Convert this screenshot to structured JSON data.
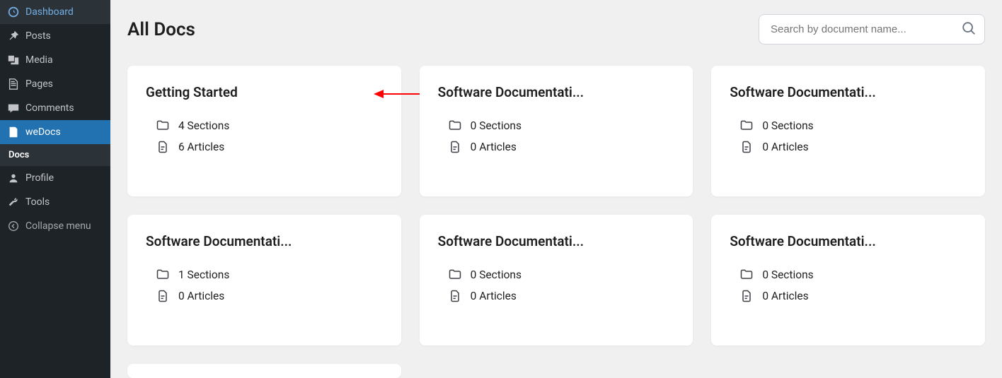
{
  "sidebar": {
    "items": [
      {
        "id": "dashboard",
        "label": "Dashboard",
        "icon": "dashboard"
      },
      {
        "id": "posts",
        "label": "Posts",
        "icon": "pin"
      },
      {
        "id": "media",
        "label": "Media",
        "icon": "media"
      },
      {
        "id": "pages",
        "label": "Pages",
        "icon": "page"
      },
      {
        "id": "comments",
        "label": "Comments",
        "icon": "comment"
      },
      {
        "id": "wedocs",
        "label": "weDocs",
        "icon": "doc",
        "active": true
      },
      {
        "id": "profile",
        "label": "Profile",
        "icon": "user"
      },
      {
        "id": "tools",
        "label": "Tools",
        "icon": "wrench"
      }
    ],
    "sub": {
      "label": "Docs"
    },
    "collapse": {
      "label": "Collapse menu"
    }
  },
  "header": {
    "title": "All Docs",
    "search_placeholder": "Search by document name..."
  },
  "docs": [
    {
      "title": "Getting Started",
      "sections": "4 Sections",
      "articles": "6 Articles",
      "highlighted": true
    },
    {
      "title": "Software Documentati...",
      "sections": "0 Sections",
      "articles": "0 Articles"
    },
    {
      "title": "Software Documentati...",
      "sections": "0 Sections",
      "articles": "0 Articles"
    },
    {
      "title": "Software Documentati...",
      "sections": "1 Sections",
      "articles": "0 Articles"
    },
    {
      "title": "Software Documentati...",
      "sections": "0 Sections",
      "articles": "0 Articles"
    },
    {
      "title": "Software Documentati...",
      "sections": "0 Sections",
      "articles": "0 Articles"
    }
  ]
}
